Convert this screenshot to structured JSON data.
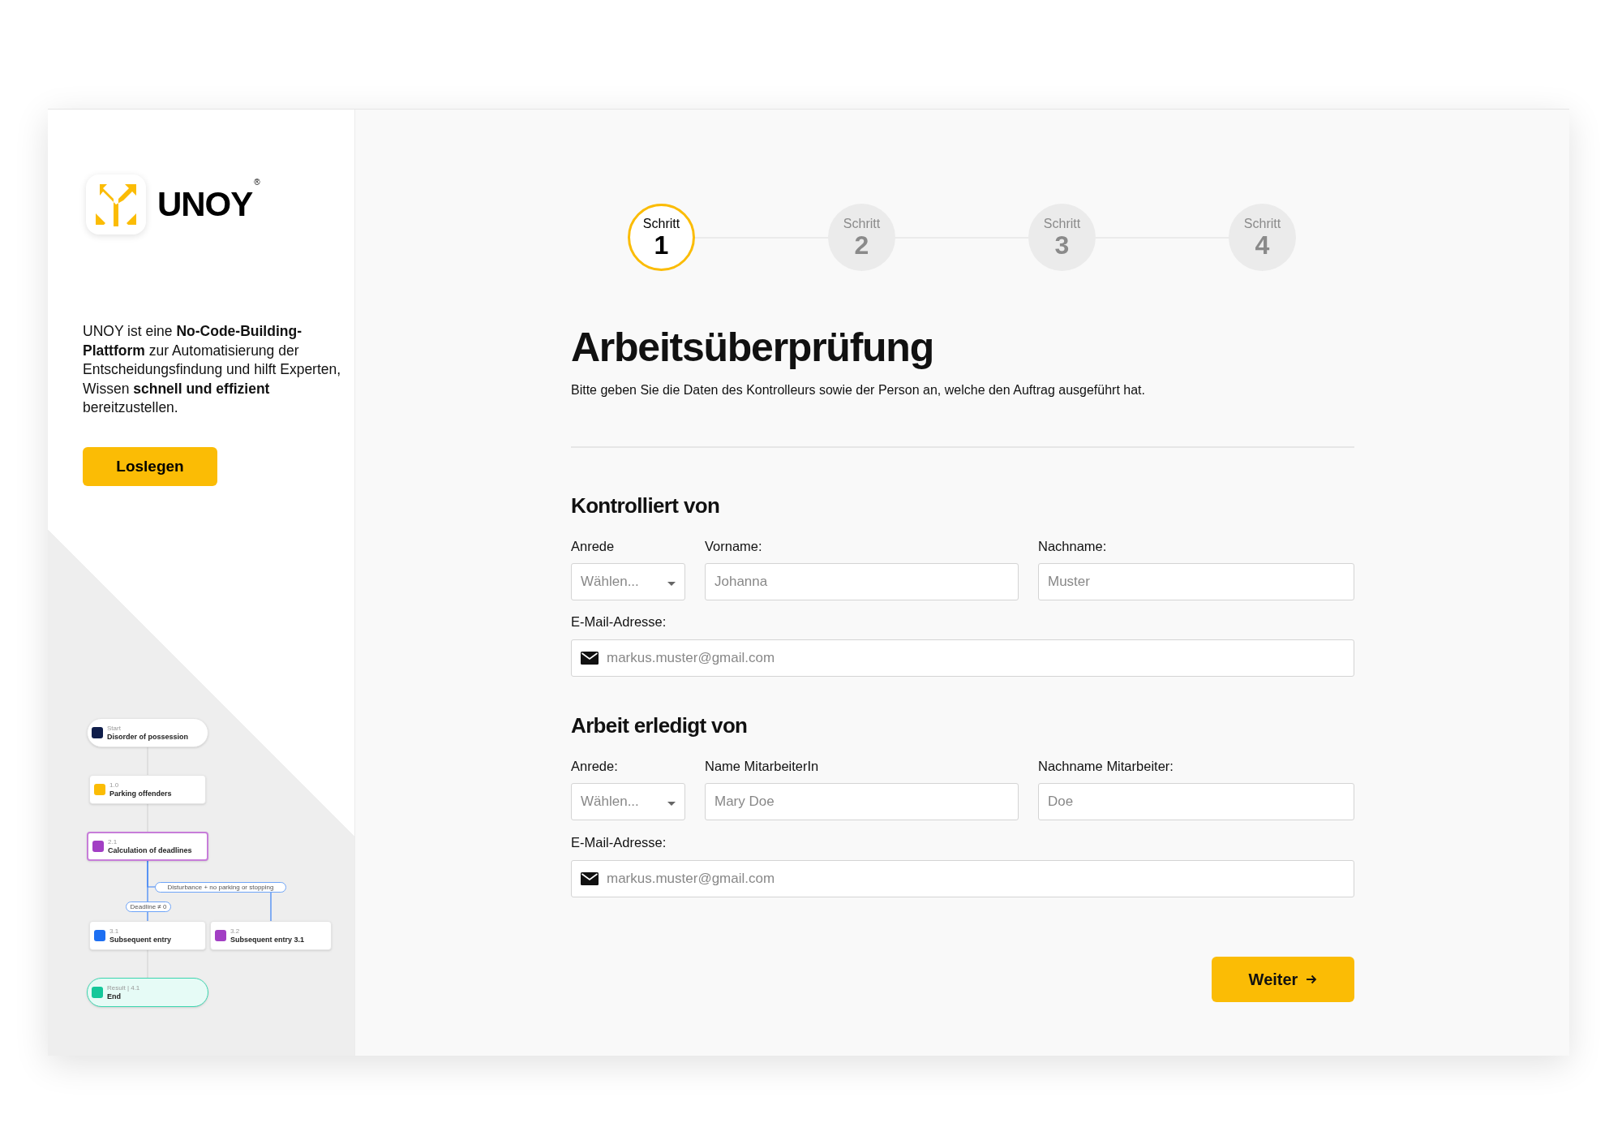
{
  "sidebar": {
    "brand": "UNOY",
    "brand_mark": "®",
    "description": "UNOY ist eine **No-Code-Building-Plattform** zur Automatisierung der Entscheidungsfindung und hilft Experten, Wissen **schnell und effizient** bereitzustellen.",
    "button": "Loslegen",
    "diagram": {
      "nodes": [
        {
          "kind": "start",
          "caption": "Start",
          "title": "Disorder of possession",
          "selected": false
        },
        {
          "kind": "document",
          "caption": "1.0",
          "title": "Parking offenders",
          "selected": false
        },
        {
          "kind": "magic",
          "caption": "2.1",
          "title": "Calculation of deadlines",
          "selected": true
        },
        {
          "kind": "list",
          "caption": "3.1",
          "title": "Subsequent entry",
          "selected": false
        },
        {
          "kind": "magic",
          "caption": "3.2",
          "title": "Subsequent entry 3.1",
          "selected": false
        },
        {
          "kind": "result",
          "caption": "Result | 4.1",
          "title": "End",
          "selected": false
        }
      ],
      "edge_labels": [
        "Deadline ≠ 0",
        "Disturbance + no parking or stopping"
      ]
    }
  },
  "steps": [
    {
      "caption": "Schritt",
      "number": "1",
      "selected": true
    },
    {
      "caption": "Schritt",
      "number": "2",
      "selected": false
    },
    {
      "caption": "Schritt",
      "number": "3",
      "selected": false
    },
    {
      "caption": "Schritt",
      "number": "4",
      "selected": false
    }
  ],
  "title": "Arbeitsüberprüfung",
  "subtitle": "Bitte geben Sie die Daten des Kontrolleurs sowie der Person an, welche den Auftrag ausgeführt hat.",
  "sections": [
    {
      "title": "Kontrolliert von",
      "fields": [
        {
          "kind": "select",
          "label": "Anrede",
          "value": "Wählen..."
        },
        {
          "kind": "text",
          "label": "Vorname:",
          "placeholder": "Johanna"
        },
        {
          "kind": "text",
          "label": "Nachname:",
          "placeholder": "Muster"
        },
        {
          "kind": "email",
          "label": "E-Mail-Adresse:",
          "placeholder": "markus.muster@gmail.com"
        }
      ]
    },
    {
      "title": "Arbeit erledigt von",
      "fields": [
        {
          "kind": "select",
          "label": "Anrede:",
          "value": "Wählen..."
        },
        {
          "kind": "text",
          "label": "Name MitarbeiterIn",
          "placeholder": "Mary Doe"
        },
        {
          "kind": "text",
          "label": "Nachname Mitarbeiter:",
          "placeholder": "Doe"
        },
        {
          "kind": "email",
          "label": "E-Mail-Adresse:",
          "placeholder": "markus.muster@gmail.com"
        }
      ]
    }
  ],
  "next_button": "Weiter"
}
